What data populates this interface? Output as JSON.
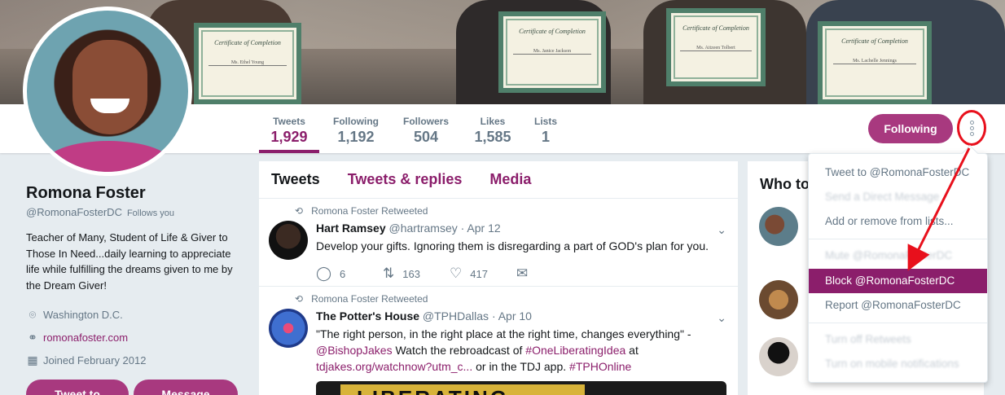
{
  "profile": {
    "name": "Romona Foster",
    "handle": "@RomonaFosterDC",
    "follows_you": "Follows you",
    "bio": "Teacher of Many, Student of Life & Giver to Those In Need...daily learning to appreciate life while fulfilling the dreams given to me by the Dream Giver!",
    "location": "Washington D.C.",
    "website": "romonafoster.com",
    "joined": "Joined February 2012",
    "tweet_to_label": "Tweet to",
    "message_label": "Message"
  },
  "stats": [
    {
      "label": "Tweets",
      "value": "1,929"
    },
    {
      "label": "Following",
      "value": "1,192"
    },
    {
      "label": "Followers",
      "value": "504"
    },
    {
      "label": "Likes",
      "value": "1,585"
    },
    {
      "label": "Lists",
      "value": "1"
    }
  ],
  "follow_button": "Following",
  "banner": {
    "certificate_title": "Certificate of Completion",
    "names": [
      "Ms. Ethel Young",
      "Ms. Janice Jackson",
      "Ms. Aitzeen Tolbert",
      "Ms. Lachelle Jennings"
    ]
  },
  "timeline": {
    "tabs": [
      "Tweets",
      "Tweets & replies",
      "Media"
    ],
    "tweets": [
      {
        "retweeted_by": "Romona Foster Retweeted",
        "author": "Hart Ramsey",
        "handle": "@hartramsey",
        "date": "· Apr 12",
        "text": "Develop your gifts. Ignoring them is disregarding a part of GOD's plan for you.",
        "replies": "6",
        "retweets": "163",
        "likes": "417"
      },
      {
        "retweeted_by": "Romona Foster Retweeted",
        "author": "The Potter's House",
        "handle": "@TPHDallas",
        "date": "· Apr 10",
        "text_1": "\"The right person, in the right place at the right time, changes everything\" -",
        "mention": "@BishopJakes",
        "text_2": " Watch the rebroadcast of ",
        "hashtag": "#OneLiberatingIdea",
        "text_3": " at",
        "link": "tdjakes.org/watchnow?utm_c...",
        "text_4": " or in the TDJ app. ",
        "hashtag2": "#TPHOnline",
        "media_text": "LIBERATING"
      }
    ]
  },
  "who_to_follow": {
    "title": "Who to follow"
  },
  "dropdown": {
    "items": [
      {
        "label": "Tweet to @RomonaFosterDC",
        "style": "normal"
      },
      {
        "label": "Send a Direct Message",
        "style": "blur"
      },
      {
        "label": "Add or remove from lists...",
        "style": "normal"
      },
      {
        "label": "Mute @RomonaFosterDC",
        "style": "blur"
      },
      {
        "label": "Block @RomonaFosterDC",
        "style": "selected"
      },
      {
        "label": "Report @RomonaFosterDC",
        "style": "normal"
      },
      {
        "label": "Turn off Retweets",
        "style": "blur"
      },
      {
        "label": "Turn on mobile notifications",
        "style": "blur"
      }
    ]
  },
  "colors": {
    "accent": "#8b1e6b",
    "button": "#a8397f",
    "annotation": "#e8101c"
  },
  "icons": [
    "location-icon",
    "link-icon",
    "calendar-icon",
    "retweet-icon",
    "reply-icon",
    "like-icon",
    "dm-icon",
    "chevron-down-icon",
    "more-icon"
  ]
}
